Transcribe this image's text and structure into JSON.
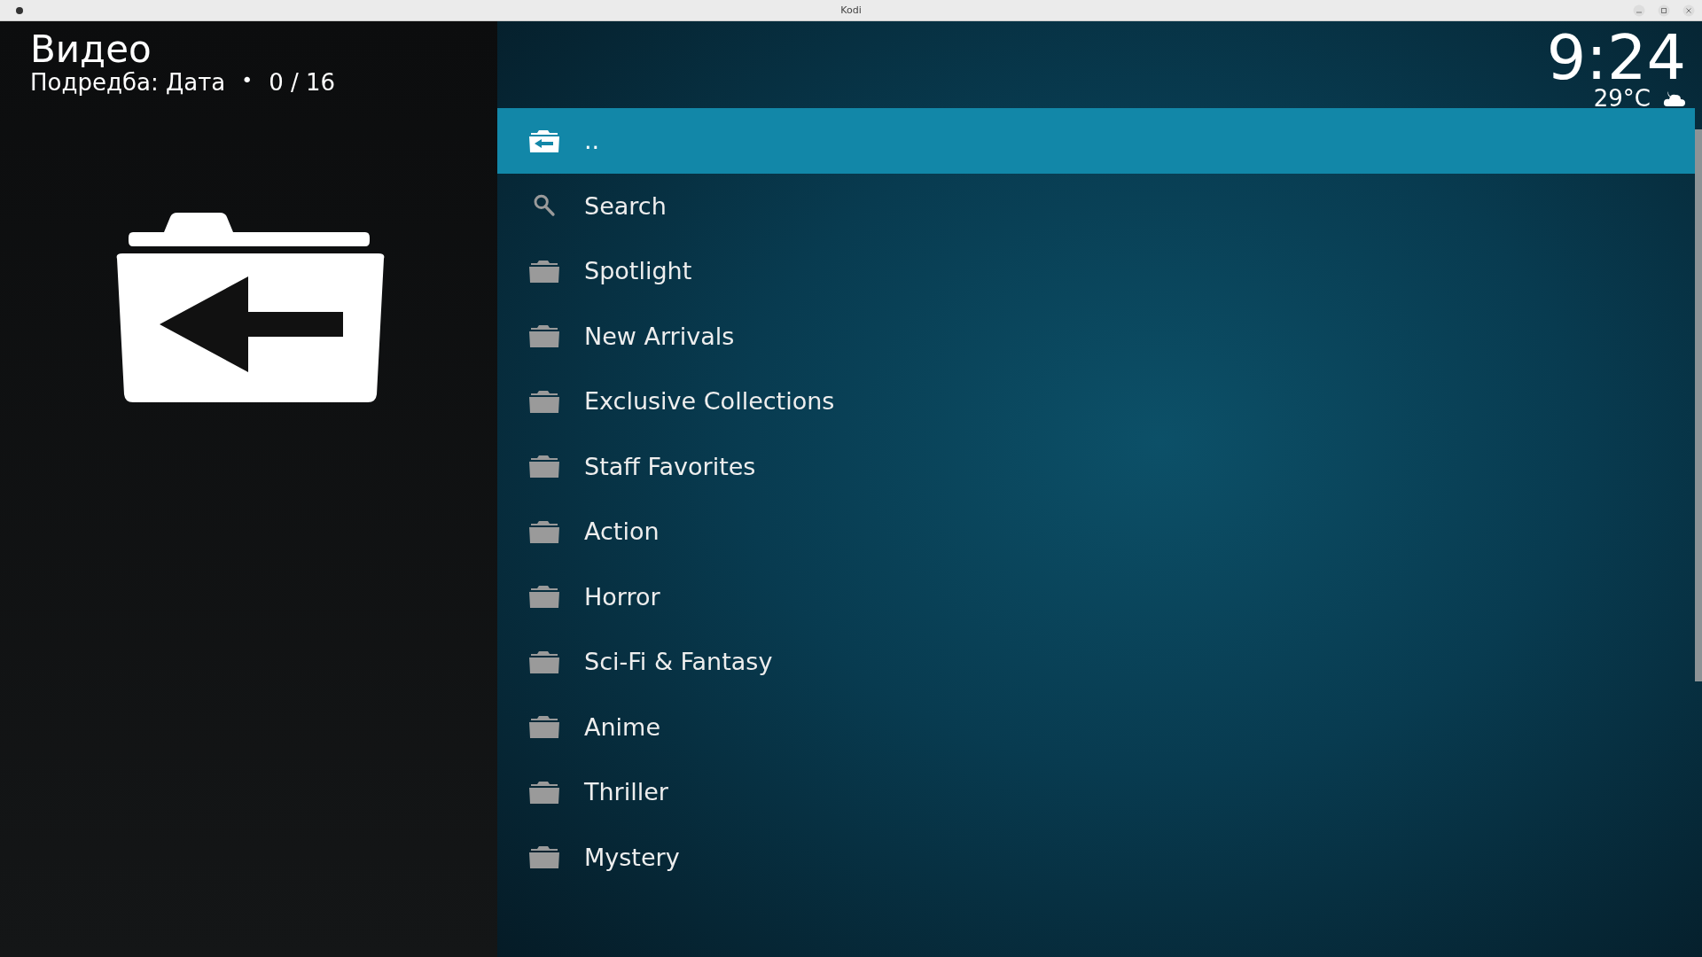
{
  "window": {
    "title": "Kodi"
  },
  "header": {
    "title": "Видео",
    "sort_label": "Подредба: Дата",
    "separator": "•",
    "count": "0 / 16"
  },
  "clock": {
    "time": "9:24",
    "temperature": "29°C"
  },
  "items": [
    {
      "label": "..",
      "kind": "parent",
      "selected": true
    },
    {
      "label": "Search",
      "kind": "search",
      "selected": false
    },
    {
      "label": "Spotlight",
      "kind": "folder",
      "selected": false
    },
    {
      "label": "New Arrivals",
      "kind": "folder",
      "selected": false
    },
    {
      "label": "Exclusive Collections",
      "kind": "folder",
      "selected": false
    },
    {
      "label": "Staff Favorites",
      "kind": "folder",
      "selected": false
    },
    {
      "label": "Action",
      "kind": "folder",
      "selected": false
    },
    {
      "label": "Horror",
      "kind": "folder",
      "selected": false
    },
    {
      "label": "Sci-Fi & Fantasy",
      "kind": "folder",
      "selected": false
    },
    {
      "label": "Anime",
      "kind": "folder",
      "selected": false
    },
    {
      "label": "Thriller",
      "kind": "folder",
      "selected": false
    },
    {
      "label": "Mystery",
      "kind": "folder",
      "selected": false
    }
  ]
}
